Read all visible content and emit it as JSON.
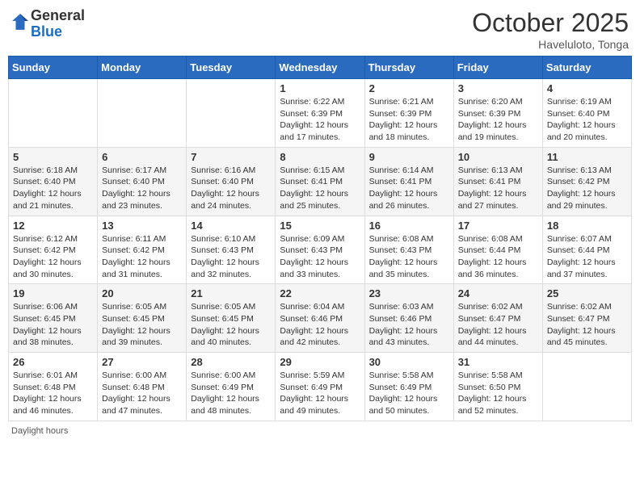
{
  "header": {
    "logo_general": "General",
    "logo_blue": "Blue",
    "month_title": "October 2025",
    "subtitle": "Haveluloto, Tonga"
  },
  "weekdays": [
    "Sunday",
    "Monday",
    "Tuesday",
    "Wednesday",
    "Thursday",
    "Friday",
    "Saturday"
  ],
  "weeks": [
    [
      {
        "day": "",
        "info": ""
      },
      {
        "day": "",
        "info": ""
      },
      {
        "day": "",
        "info": ""
      },
      {
        "day": "1",
        "info": "Sunrise: 6:22 AM\nSunset: 6:39 PM\nDaylight: 12 hours and 17 minutes."
      },
      {
        "day": "2",
        "info": "Sunrise: 6:21 AM\nSunset: 6:39 PM\nDaylight: 12 hours and 18 minutes."
      },
      {
        "day": "3",
        "info": "Sunrise: 6:20 AM\nSunset: 6:39 PM\nDaylight: 12 hours and 19 minutes."
      },
      {
        "day": "4",
        "info": "Sunrise: 6:19 AM\nSunset: 6:40 PM\nDaylight: 12 hours and 20 minutes."
      }
    ],
    [
      {
        "day": "5",
        "info": "Sunrise: 6:18 AM\nSunset: 6:40 PM\nDaylight: 12 hours and 21 minutes."
      },
      {
        "day": "6",
        "info": "Sunrise: 6:17 AM\nSunset: 6:40 PM\nDaylight: 12 hours and 23 minutes."
      },
      {
        "day": "7",
        "info": "Sunrise: 6:16 AM\nSunset: 6:40 PM\nDaylight: 12 hours and 24 minutes."
      },
      {
        "day": "8",
        "info": "Sunrise: 6:15 AM\nSunset: 6:41 PM\nDaylight: 12 hours and 25 minutes."
      },
      {
        "day": "9",
        "info": "Sunrise: 6:14 AM\nSunset: 6:41 PM\nDaylight: 12 hours and 26 minutes."
      },
      {
        "day": "10",
        "info": "Sunrise: 6:13 AM\nSunset: 6:41 PM\nDaylight: 12 hours and 27 minutes."
      },
      {
        "day": "11",
        "info": "Sunrise: 6:13 AM\nSunset: 6:42 PM\nDaylight: 12 hours and 29 minutes."
      }
    ],
    [
      {
        "day": "12",
        "info": "Sunrise: 6:12 AM\nSunset: 6:42 PM\nDaylight: 12 hours and 30 minutes."
      },
      {
        "day": "13",
        "info": "Sunrise: 6:11 AM\nSunset: 6:42 PM\nDaylight: 12 hours and 31 minutes."
      },
      {
        "day": "14",
        "info": "Sunrise: 6:10 AM\nSunset: 6:43 PM\nDaylight: 12 hours and 32 minutes."
      },
      {
        "day": "15",
        "info": "Sunrise: 6:09 AM\nSunset: 6:43 PM\nDaylight: 12 hours and 33 minutes."
      },
      {
        "day": "16",
        "info": "Sunrise: 6:08 AM\nSunset: 6:43 PM\nDaylight: 12 hours and 35 minutes."
      },
      {
        "day": "17",
        "info": "Sunrise: 6:08 AM\nSunset: 6:44 PM\nDaylight: 12 hours and 36 minutes."
      },
      {
        "day": "18",
        "info": "Sunrise: 6:07 AM\nSunset: 6:44 PM\nDaylight: 12 hours and 37 minutes."
      }
    ],
    [
      {
        "day": "19",
        "info": "Sunrise: 6:06 AM\nSunset: 6:45 PM\nDaylight: 12 hours and 38 minutes."
      },
      {
        "day": "20",
        "info": "Sunrise: 6:05 AM\nSunset: 6:45 PM\nDaylight: 12 hours and 39 minutes."
      },
      {
        "day": "21",
        "info": "Sunrise: 6:05 AM\nSunset: 6:45 PM\nDaylight: 12 hours and 40 minutes."
      },
      {
        "day": "22",
        "info": "Sunrise: 6:04 AM\nSunset: 6:46 PM\nDaylight: 12 hours and 42 minutes."
      },
      {
        "day": "23",
        "info": "Sunrise: 6:03 AM\nSunset: 6:46 PM\nDaylight: 12 hours and 43 minutes."
      },
      {
        "day": "24",
        "info": "Sunrise: 6:02 AM\nSunset: 6:47 PM\nDaylight: 12 hours and 44 minutes."
      },
      {
        "day": "25",
        "info": "Sunrise: 6:02 AM\nSunset: 6:47 PM\nDaylight: 12 hours and 45 minutes."
      }
    ],
    [
      {
        "day": "26",
        "info": "Sunrise: 6:01 AM\nSunset: 6:48 PM\nDaylight: 12 hours and 46 minutes."
      },
      {
        "day": "27",
        "info": "Sunrise: 6:00 AM\nSunset: 6:48 PM\nDaylight: 12 hours and 47 minutes."
      },
      {
        "day": "28",
        "info": "Sunrise: 6:00 AM\nSunset: 6:49 PM\nDaylight: 12 hours and 48 minutes."
      },
      {
        "day": "29",
        "info": "Sunrise: 5:59 AM\nSunset: 6:49 PM\nDaylight: 12 hours and 49 minutes."
      },
      {
        "day": "30",
        "info": "Sunrise: 5:58 AM\nSunset: 6:49 PM\nDaylight: 12 hours and 50 minutes."
      },
      {
        "day": "31",
        "info": "Sunrise: 5:58 AM\nSunset: 6:50 PM\nDaylight: 12 hours and 52 minutes."
      },
      {
        "day": "",
        "info": ""
      }
    ]
  ],
  "footer": {
    "daylight_label": "Daylight hours"
  }
}
